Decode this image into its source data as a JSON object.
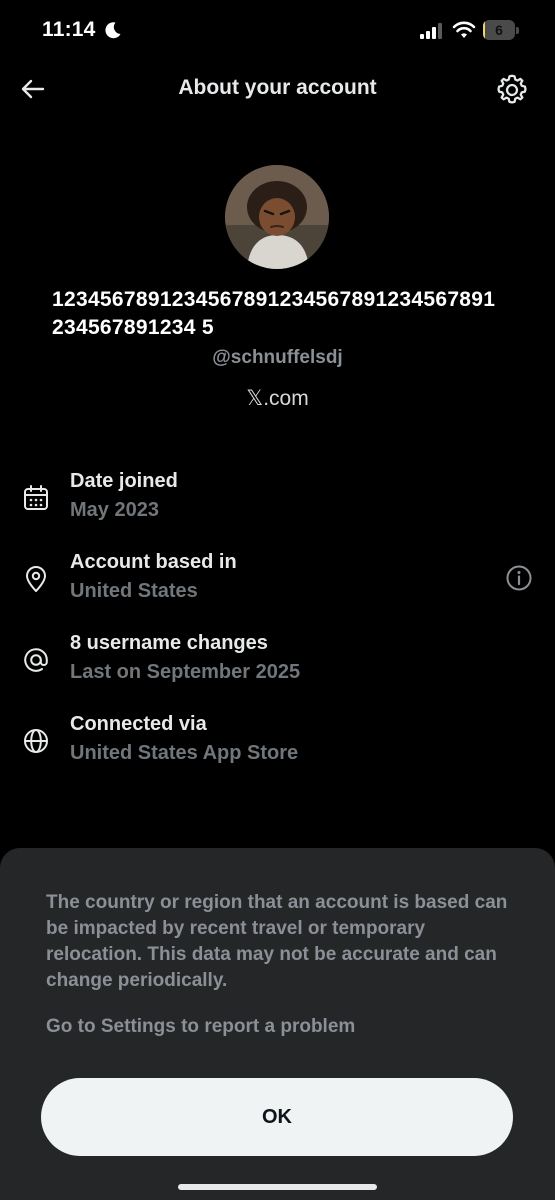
{
  "status_bar": {
    "time": "11:14",
    "battery_level": "6",
    "battery_fraction": 0.06,
    "battery_color": "#f3d36a"
  },
  "header": {
    "title": "About your account",
    "back_icon": "arrow-left-icon",
    "settings_icon": "gear-icon"
  },
  "profile": {
    "display_name": "1234567891234567891234567891234567891234567891234 5",
    "handle": "@schnuffelsdj",
    "site": "𝕏.com"
  },
  "info_rows": [
    {
      "icon": "calendar-icon",
      "title": "Date joined",
      "value": "May 2023"
    },
    {
      "icon": "location-pin-icon",
      "title": "Account based in",
      "value": "United States",
      "action_icon": "info-icon"
    },
    {
      "icon": "at-sign-icon",
      "title": "8 username changes",
      "value": "Last on September 2025"
    },
    {
      "icon": "globe-icon",
      "title": "Connected via",
      "value": "United States App Store"
    }
  ],
  "sheet": {
    "message": "The country or region that an account is based can be impacted by recent travel or temporary relocation. This data may not be accurate and can change periodically.",
    "link": "Go to Settings to report a problem",
    "ok_label": "OK"
  },
  "colors": {
    "background": "#000000",
    "sheet_background": "#242628",
    "muted_text": "#71767b",
    "button_background": "#eff3f4"
  }
}
